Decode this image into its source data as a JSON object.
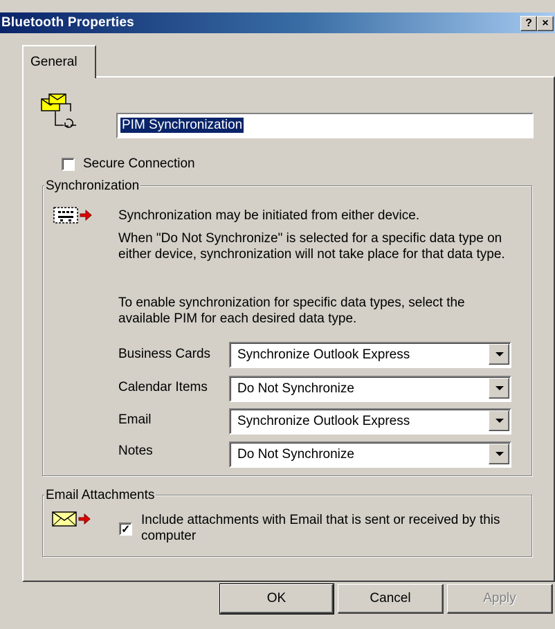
{
  "window": {
    "title": "Bluetooth Properties",
    "help_glyph": "?",
    "close_glyph": "×"
  },
  "tabs": [
    {
      "label": "General"
    }
  ],
  "general": {
    "service_name": "PIM Synchronization",
    "secure_connection_label": "Secure Connection",
    "secure_connection_checked": false
  },
  "synchronization": {
    "legend": "Synchronization",
    "info_line1": "Synchronization may be initiated from either device.",
    "info_line2": "When \"Do Not Synchronize\" is selected for a specific data type on either device, synchronization will not take place for that data type.",
    "info_line3": "To enable synchronization for specific data types, select the available PIM for each desired data type.",
    "rows": [
      {
        "label": "Business Cards",
        "value": "Synchronize Outlook Express"
      },
      {
        "label": "Calendar Items",
        "value": "Do Not Synchronize"
      },
      {
        "label": "Email",
        "value": "Synchronize Outlook Express"
      },
      {
        "label": "Notes",
        "value": "Do Not Synchronize"
      }
    ]
  },
  "email_attachments": {
    "legend": "Email Attachments",
    "include_label": "Include attachments with Email that is sent or received by this computer",
    "include_checked": true
  },
  "buttons": {
    "ok": "OK",
    "cancel": "Cancel",
    "apply": "Apply"
  },
  "colors": {
    "title_bar": "#0a246a",
    "dialog_face": "#d4d0c8",
    "selection": "#0a246a",
    "arrow_red": "#e00000"
  }
}
